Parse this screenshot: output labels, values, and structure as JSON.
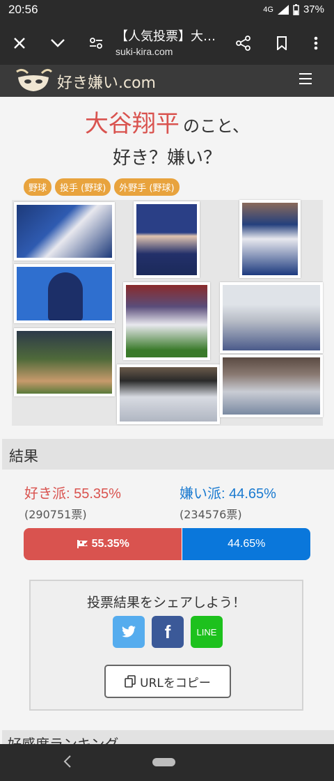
{
  "status": {
    "time": "20:56",
    "network": "4G",
    "battery": "37%"
  },
  "browser": {
    "title": "【人気投票】大…",
    "url": "suki-kira.com"
  },
  "site": {
    "logo_text": "好き嫌い.com"
  },
  "subject": {
    "name": "大谷翔平",
    "suffix": "のこと、",
    "question": "好き？嫌い？"
  },
  "tags": [
    "野球",
    "投手 (野球)",
    "外野手 (野球)"
  ],
  "results": {
    "heading": "結果",
    "like_label": "好き派: 55.35%",
    "like_votes": "(290751票)",
    "dislike_label": "嫌い派: 44.65%",
    "dislike_votes": "(234576票)",
    "like_bar_text": "55.35%",
    "dislike_bar_text": "44.65%",
    "like_fraction": 0.5535
  },
  "share": {
    "title": "投票結果をシェアしよう！",
    "twitter": "twitter-icon",
    "facebook": "f",
    "line": "LINE",
    "copy_label": "URLをコピー"
  },
  "next_section": "好感度ランキング",
  "colors": {
    "like": "#d9534f",
    "dislike": "#0a77db",
    "tag": "#e8a33d"
  }
}
